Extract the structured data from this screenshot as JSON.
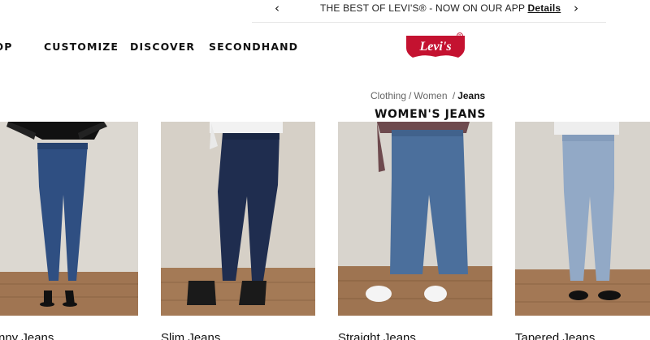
{
  "promo": {
    "text": "THE BEST OF LEVI'S® - NOW ON OUR APP",
    "link": "Details"
  },
  "nav": {
    "items": [
      "HOP",
      "CUSTOMIZE",
      "DISCOVER",
      "SECONDHAND"
    ]
  },
  "logo": {
    "text": "Levi's",
    "brand_color": "#c41230"
  },
  "breadcrumb": {
    "items": [
      "Clothing",
      "Women",
      "Jeans"
    ]
  },
  "page_title": "WOMEN'S JEANS",
  "products": [
    {
      "name": "nny Jeans"
    },
    {
      "name": "Slim Jeans"
    },
    {
      "name": "Straight Jeans"
    },
    {
      "name": "Tapered Jeans"
    }
  ],
  "icons": {
    "prev": "chevron-left-icon",
    "next": "chevron-right-icon"
  }
}
